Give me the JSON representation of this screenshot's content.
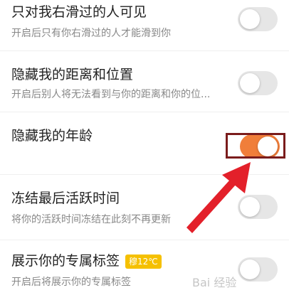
{
  "settings": [
    {
      "title": "只对我右滑过的人可见",
      "subtitle": "开启后只有你右滑过的人才能滑到你",
      "enabled": false
    },
    {
      "title": "隐藏我的距离和位置",
      "subtitle": "开启后别人将无法看到与你的距离和你的位...",
      "enabled": false
    },
    {
      "title": "隐藏我的年龄",
      "subtitle": "",
      "enabled": true
    },
    {
      "title": "冻结最后活跃时间",
      "subtitle": "将你的活跃时间冻结在此刻不再更新",
      "enabled": false
    },
    {
      "title": "展示你的专属标签",
      "subtitle": "开启后将展示你的专属标签",
      "badge": "穆12℃",
      "enabled": false
    }
  ],
  "colors": {
    "toggle_on": "#f07e3a",
    "toggle_off": "#e6e6e6",
    "highlight_box": "#7a1c1c",
    "arrow": "#e3202a",
    "badge": "#f5c000"
  },
  "watermark": "Bai 经验"
}
